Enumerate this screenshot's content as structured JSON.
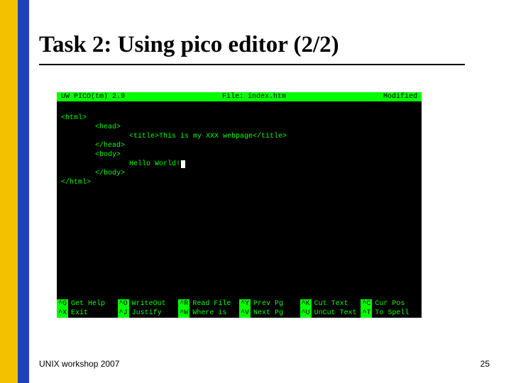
{
  "slide": {
    "title": "Task 2: Using pico editor (2/2)",
    "footer_left": "UNIX workshop 2007",
    "page_number": "25"
  },
  "pico": {
    "header": {
      "version": "UW PICO(tm) 2.9",
      "file_label": "File: index.htm",
      "modified": "Modified"
    },
    "body_lines": [
      "<html>",
      "        <head>",
      "                <title>This is my XXX webpage</title>",
      "        </head>",
      "        <body>",
      "                Hello World!",
      "        </body>",
      "</html>"
    ],
    "shortcuts_row1": [
      {
        "key": "^G",
        "label": "Get Help"
      },
      {
        "key": "^O",
        "label": "WriteOut"
      },
      {
        "key": "^R",
        "label": "Read File"
      },
      {
        "key": "^Y",
        "label": "Prev Pg"
      },
      {
        "key": "^K",
        "label": "Cut Text"
      },
      {
        "key": "^C",
        "label": "Cur Pos"
      }
    ],
    "shortcuts_row2": [
      {
        "key": "^X",
        "label": "Exit"
      },
      {
        "key": "^J",
        "label": "Justify"
      },
      {
        "key": "^W",
        "label": "Where is"
      },
      {
        "key": "^V",
        "label": "Next Pg"
      },
      {
        "key": "^U",
        "label": "UnCut Text"
      },
      {
        "key": "^T",
        "label": "To Spell"
      }
    ]
  }
}
